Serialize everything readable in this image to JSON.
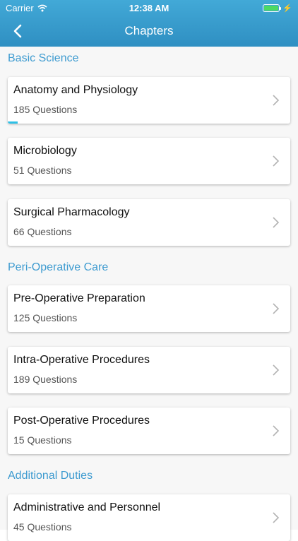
{
  "status_bar": {
    "carrier": "Carrier",
    "time": "12:38 AM",
    "battery_color": "#4cd964"
  },
  "nav": {
    "title": "Chapters",
    "back_icon": "chevron-left-icon"
  },
  "accent_color": "#3e9bd0",
  "sections": [
    {
      "title": "Basic Science",
      "items": [
        {
          "title": "Anatomy and Physiology",
          "count": "185 Questions",
          "progress": 0.035
        },
        {
          "title": "Microbiology",
          "count": "51 Questions",
          "progress": 0
        },
        {
          "title": "Surgical Pharmacology",
          "count": "66 Questions",
          "progress": 0
        }
      ]
    },
    {
      "title": "Peri-Operative Care",
      "items": [
        {
          "title": "Pre-Operative Preparation",
          "count": "125 Questions",
          "progress": 0
        },
        {
          "title": "Intra-Operative Procedures",
          "count": "189 Questions",
          "progress": 0
        },
        {
          "title": "Post-Operative Procedures",
          "count": "15 Questions",
          "progress": 0
        }
      ]
    },
    {
      "title": "Additional Duties",
      "items": [
        {
          "title": "Administrative and Personnel",
          "count": "45 Questions",
          "progress": 0
        }
      ]
    }
  ]
}
